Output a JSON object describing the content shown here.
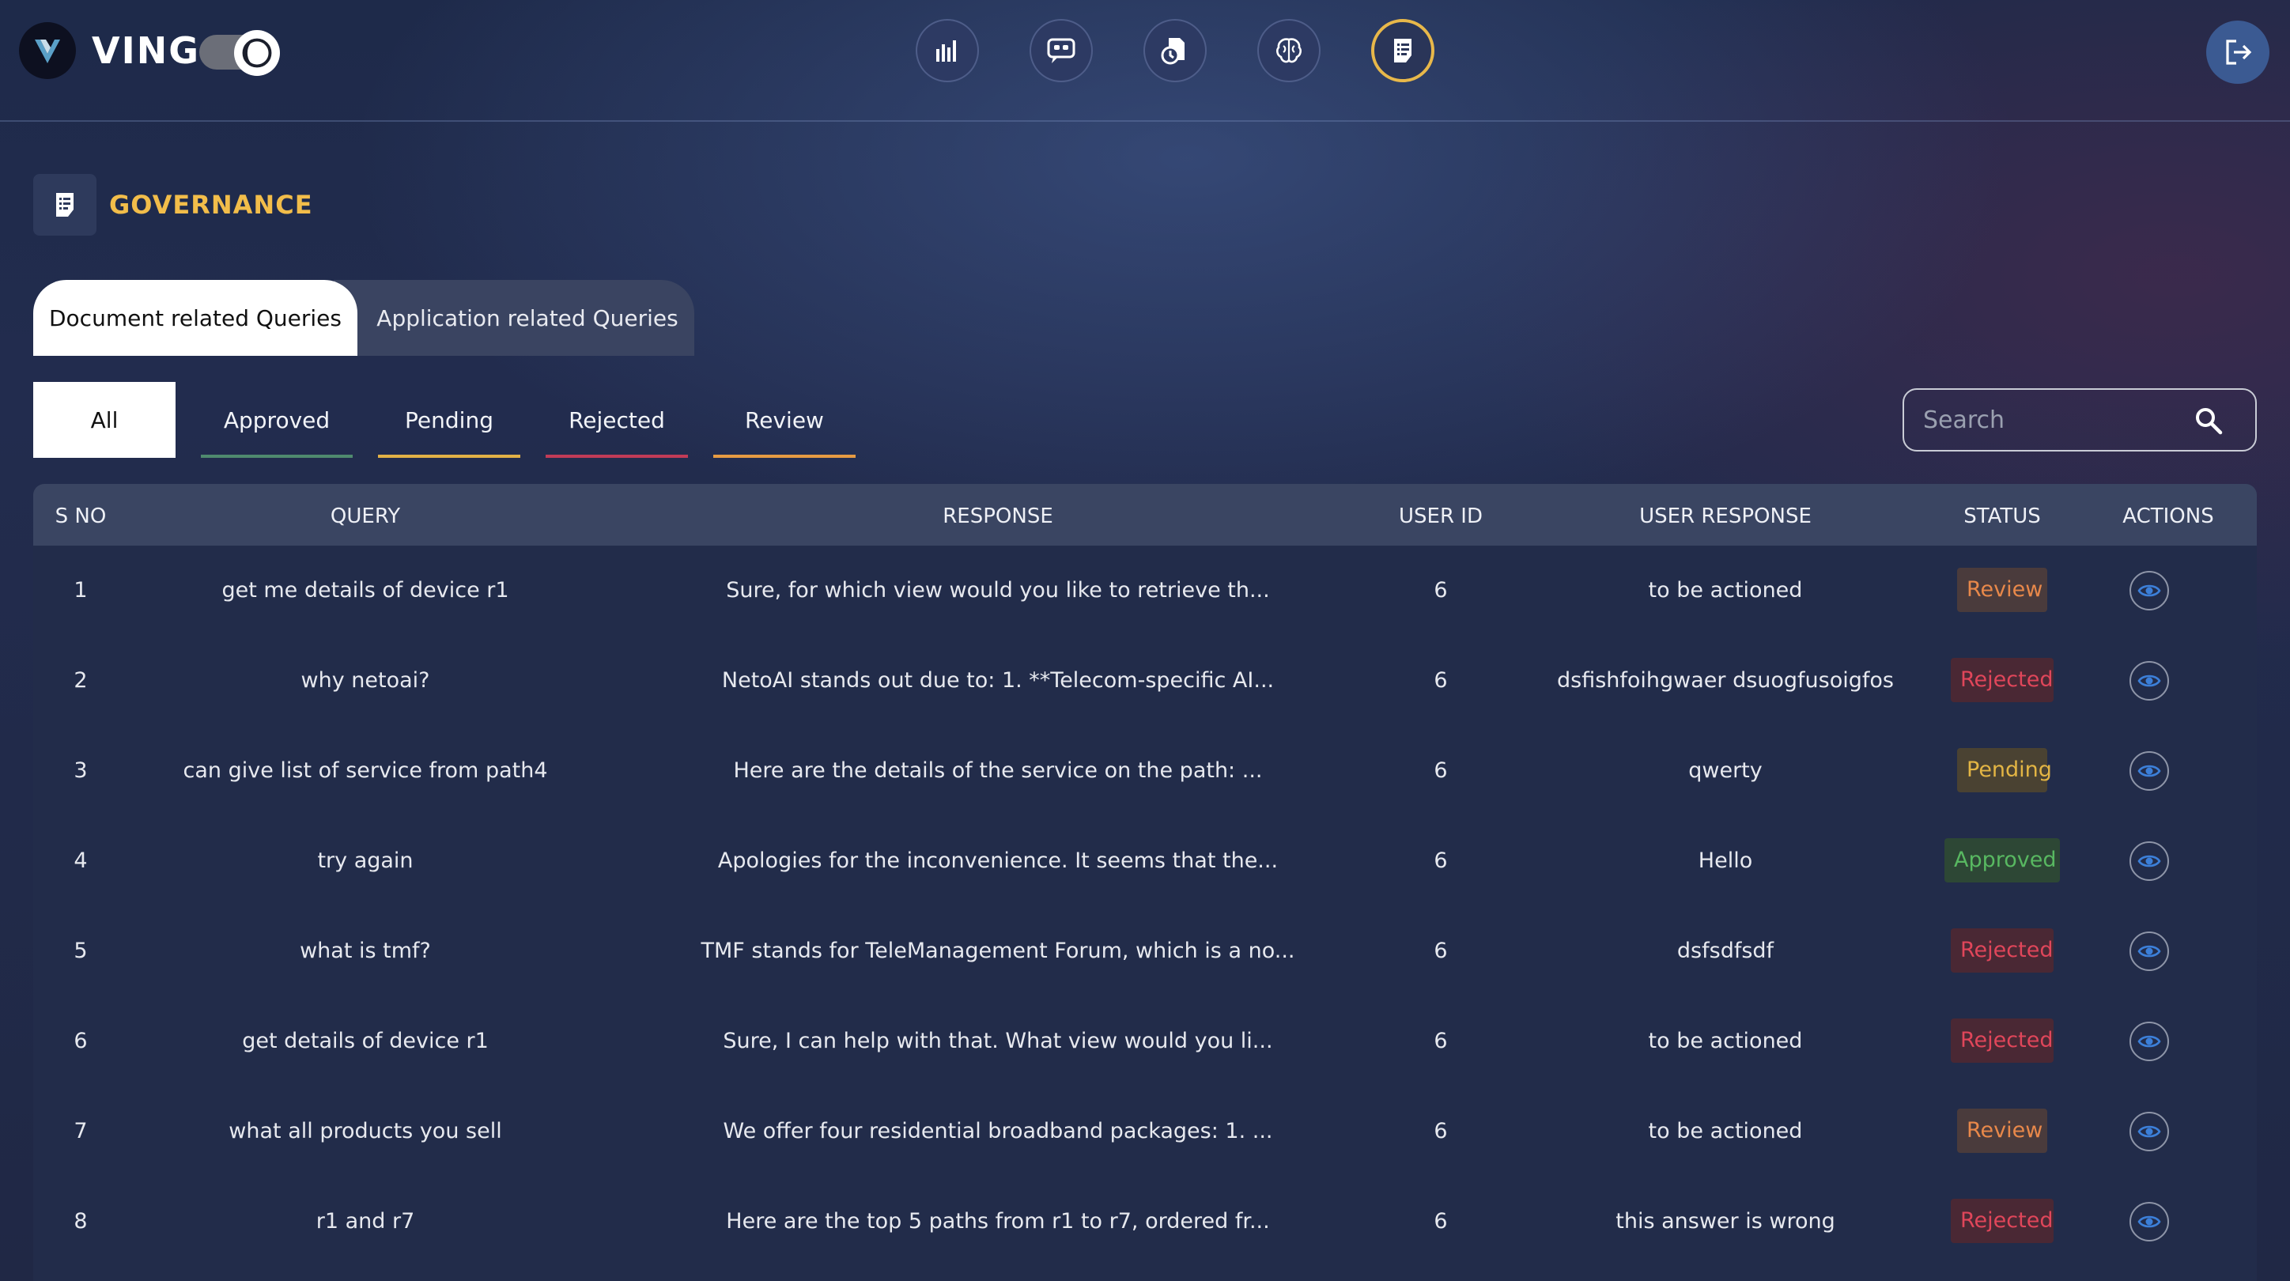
{
  "app": {
    "name": "VING"
  },
  "nav": [
    {
      "name": "analytics-icon",
      "active": false
    },
    {
      "name": "chat-icon",
      "active": false
    },
    {
      "name": "documents-icon",
      "active": false
    },
    {
      "name": "brain-icon",
      "active": false
    },
    {
      "name": "governance-icon",
      "active": true
    }
  ],
  "page": {
    "title": "GOVERNANCE"
  },
  "tabs": [
    {
      "label": "Document related Queries",
      "active": true
    },
    {
      "label": "Application related Queries",
      "active": false
    }
  ],
  "filters": {
    "all": "All",
    "approved": "Approved",
    "pending": "Pending",
    "rejected": "Rejected",
    "review": "Review",
    "active": "all",
    "colors": {
      "approved": "#4f8a6e",
      "pending": "#e2b146",
      "rejected": "#c23b57",
      "review": "#e69b43"
    }
  },
  "search": {
    "placeholder": "Search"
  },
  "table": {
    "headers": {
      "sno": "S NO",
      "query": "QUERY",
      "response": "RESPONSE",
      "user_id": "USER ID",
      "user_response": "USER RESPONSE",
      "status": "STATUS",
      "actions": "ACTIONS"
    },
    "rows": [
      {
        "sno": "1",
        "query": "get me details of device r1",
        "response": "Sure, for which view would you like to retrieve th...",
        "user_id": "6",
        "user_response": "to be actioned",
        "status": "Review"
      },
      {
        "sno": "2",
        "query": "why netoai?",
        "response": "NetoAI stands out due to: 1. **Telecom-specific AI...",
        "user_id": "6",
        "user_response": "dsfishfoihgwaer dsuogfusoigfos",
        "status": "Rejected"
      },
      {
        "sno": "3",
        "query": "can give list of service from path4",
        "response": "Here are the details of the service on the path: ...",
        "user_id": "6",
        "user_response": "qwerty",
        "status": "Pending"
      },
      {
        "sno": "4",
        "query": "try again",
        "response": "Apologies for the inconvenience. It seems that the...",
        "user_id": "6",
        "user_response": "Hello",
        "status": "Approved"
      },
      {
        "sno": "5",
        "query": "what is tmf?",
        "response": "TMF stands for TeleManagement Forum, which is a no...",
        "user_id": "6",
        "user_response": "dsfsdfsdf",
        "status": "Rejected"
      },
      {
        "sno": "6",
        "query": "get details of device r1",
        "response": "Sure, I can help with that. What view would you li...",
        "user_id": "6",
        "user_response": "to be actioned",
        "status": "Rejected"
      },
      {
        "sno": "7",
        "query": "what all products you sell",
        "response": "We offer four residential broadband packages: 1. ...",
        "user_id": "6",
        "user_response": "to be actioned",
        "status": "Review"
      },
      {
        "sno": "8",
        "query": "r1 and r7",
        "response": "Here are the top 5 paths from r1 to r7, ordered fr...",
        "user_id": "6",
        "user_response": "this answer is wrong",
        "status": "Rejected"
      }
    ]
  }
}
